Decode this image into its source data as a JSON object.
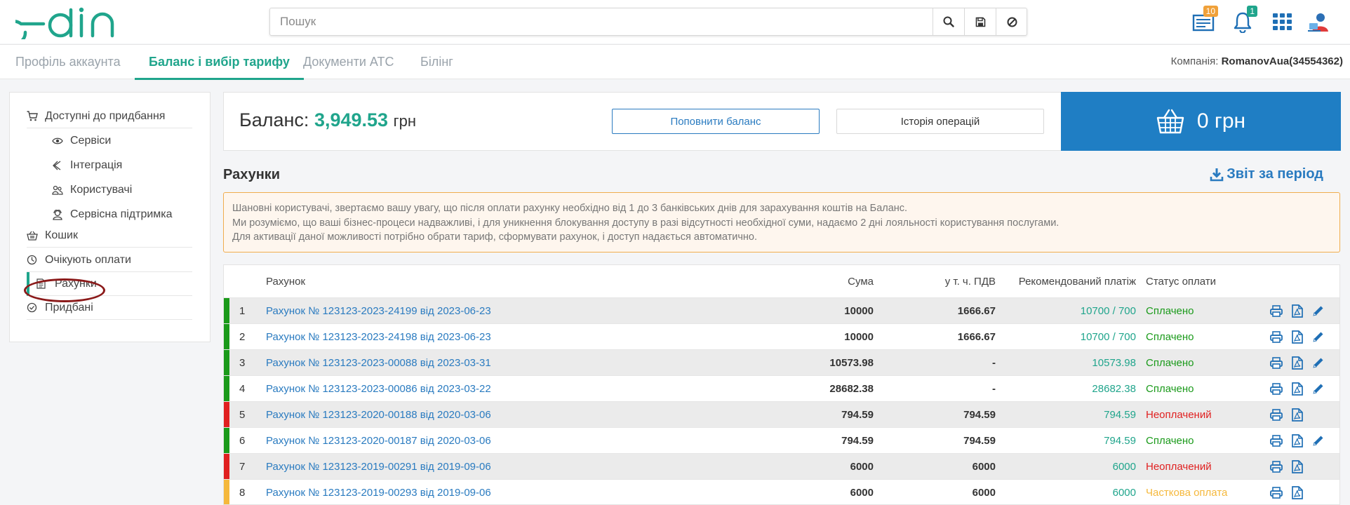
{
  "header": {
    "logo_text": "edin",
    "search_placeholder": "Пошук",
    "icons": [
      "search-icon",
      "save-icon",
      "cancel-icon"
    ],
    "documents_badge": "10",
    "notifications_badge": "1",
    "colors": {
      "brand": "#20a58c",
      "badge_orange": "#f0a13a",
      "badge_green": "#20a58c"
    }
  },
  "tabs": [
    {
      "label": "Профіль аккаунта",
      "active": false
    },
    {
      "label": "Баланс і вибір тарифу",
      "active": true
    },
    {
      "label": "Документи АТС",
      "active": false
    },
    {
      "label": "Білінг",
      "active": false
    }
  ],
  "company": {
    "label": "Компанія:",
    "value": "RomanovAua(34554362)"
  },
  "sidebar": {
    "items": [
      {
        "label": "Доступні до придбання",
        "icon": "cart-icon"
      },
      {
        "label": "Сервіси",
        "icon": "eye-icon"
      },
      {
        "label": "Інтеграція",
        "icon": "integration-icon"
      },
      {
        "label": "Користувачі",
        "icon": "users-icon"
      },
      {
        "label": "Сервісна підтримка",
        "icon": "support-icon"
      },
      {
        "label": "Кошик",
        "icon": "basket-icon"
      },
      {
        "label": "Очікують оплати",
        "icon": "clock-icon"
      },
      {
        "label": "Рахунки",
        "icon": "document-icon",
        "active": true
      },
      {
        "label": "Придбані",
        "icon": "check-circle-icon"
      }
    ]
  },
  "balance": {
    "label": "Баланс:",
    "value": "3,949.53",
    "currency": "грн",
    "topup_button": "Поповнити баланс",
    "history_button": "Історія операцій",
    "cart_amount": "0 грн"
  },
  "invoices": {
    "title": "Рахунки",
    "report_link": "Звіт за період",
    "notice_lines": [
      "Шановні користувачі, звертаємо вашу увагу, що після оплати рахунку необхідно від 1 до 3 банківських днів для зарахування коштів на Баланс.",
      "Ми розуміємо, що ваші бізнес-процеси надважливі, і для уникнення блокування доступу в разі відсутності необхідної суми, надаємо 2 дні лояльності користування послугами.",
      "Для активації даної можливості потрібно обрати тариф, сформувати рахунок, і доступ надається автоматично."
    ],
    "columns": {
      "invoice": "Рахунок",
      "sum": "Сума",
      "vat": "у т. ч. ПДВ",
      "recommended": "Рекомендований платіж",
      "status": "Статус оплати"
    },
    "status_colors": {
      "paid": "#1a9a1a",
      "unpaid": "#e02020",
      "partial": "#f5b83c"
    },
    "rows": [
      {
        "num": "1",
        "name": "Рахунок № 123123-2023-24199 від 2023-06-23",
        "sum": "10000",
        "vat": "1666.67",
        "recommended": "10700 / 700",
        "status": "Сплачено",
        "state": "paid",
        "editable": true
      },
      {
        "num": "2",
        "name": "Рахунок № 123123-2023-24198 від 2023-06-23",
        "sum": "10000",
        "vat": "1666.67",
        "recommended": "10700 / 700",
        "status": "Сплачено",
        "state": "paid",
        "editable": true
      },
      {
        "num": "3",
        "name": "Рахунок № 123123-2023-00088 від 2023-03-31",
        "sum": "10573.98",
        "vat": "-",
        "recommended": "10573.98",
        "status": "Сплачено",
        "state": "paid",
        "editable": true
      },
      {
        "num": "4",
        "name": "Рахунок № 123123-2023-00086 від 2023-03-22",
        "sum": "28682.38",
        "vat": "-",
        "recommended": "28682.38",
        "status": "Сплачено",
        "state": "paid",
        "editable": true
      },
      {
        "num": "5",
        "name": "Рахунок № 123123-2020-00188 від 2020-03-06",
        "sum": "794.59",
        "vat": "794.59",
        "recommended": "794.59",
        "status": "Неоплачений",
        "state": "unpaid",
        "editable": false
      },
      {
        "num": "6",
        "name": "Рахунок № 123123-2020-00187 від 2020-03-06",
        "sum": "794.59",
        "vat": "794.59",
        "recommended": "794.59",
        "status": "Сплачено",
        "state": "paid",
        "editable": true
      },
      {
        "num": "7",
        "name": "Рахунок № 123123-2019-00291 від 2019-09-06",
        "sum": "6000",
        "vat": "6000",
        "recommended": "6000",
        "status": "Неоплачений",
        "state": "unpaid",
        "editable": false
      },
      {
        "num": "8",
        "name": "Рахунок № 123123-2019-00293 від 2019-09-06",
        "sum": "6000",
        "vat": "6000",
        "recommended": "6000",
        "status": "Часткова оплата",
        "state": "partial",
        "editable": false
      }
    ]
  }
}
